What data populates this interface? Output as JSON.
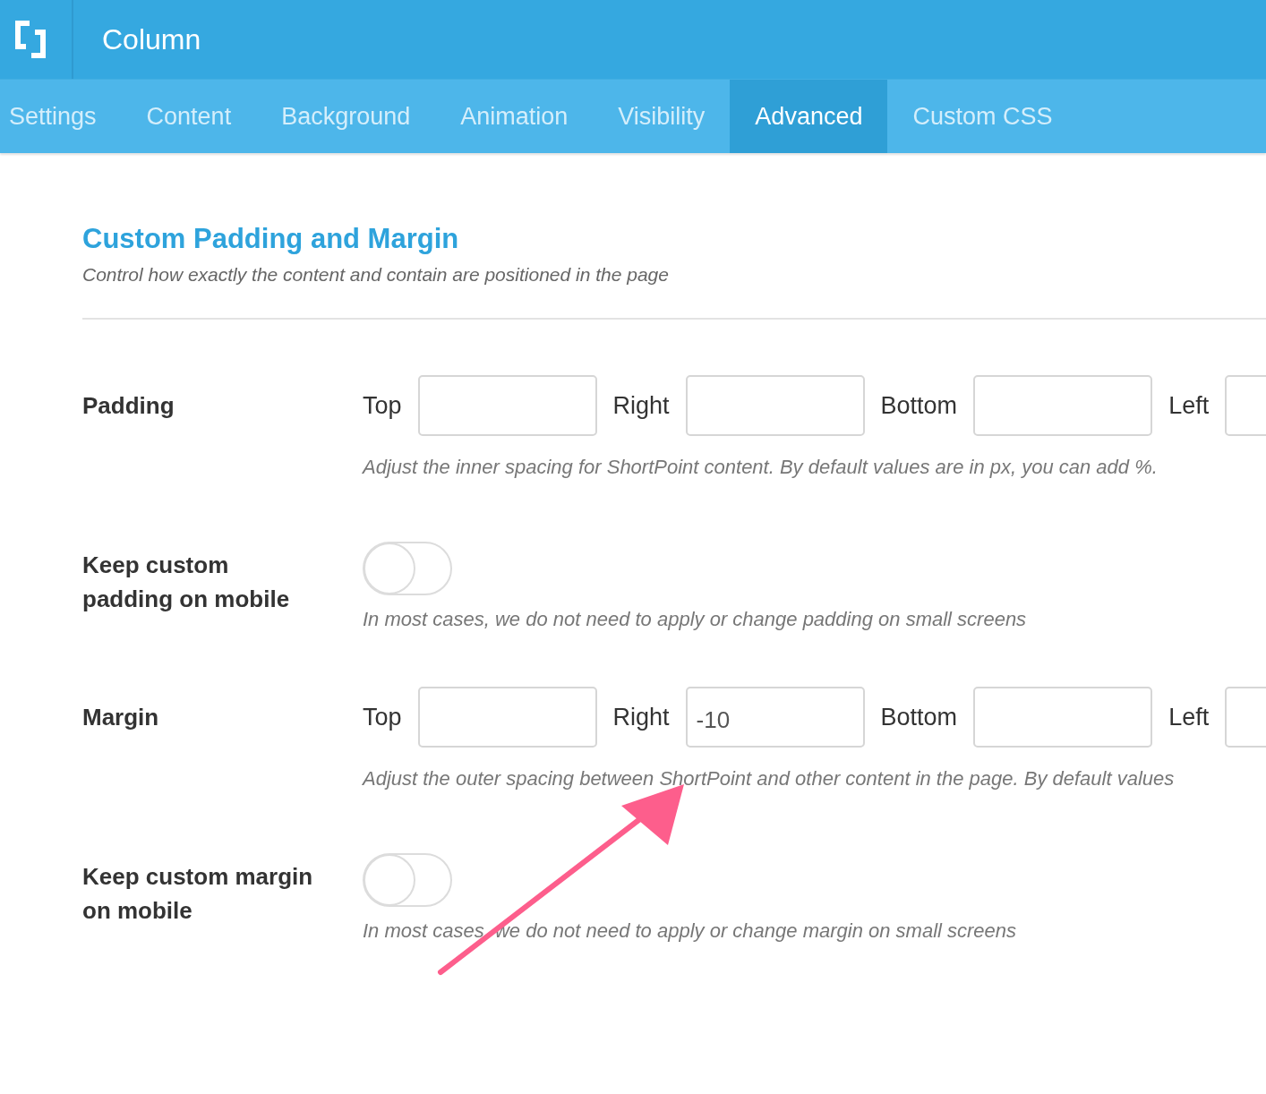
{
  "header": {
    "title": "Column"
  },
  "tabs": [
    {
      "label": "Settings",
      "selected": false
    },
    {
      "label": "Content",
      "selected": false
    },
    {
      "label": "Background",
      "selected": false
    },
    {
      "label": "Animation",
      "selected": false
    },
    {
      "label": "Visibility",
      "selected": false
    },
    {
      "label": "Advanced",
      "selected": true
    },
    {
      "label": "Custom CSS",
      "selected": false
    }
  ],
  "section": {
    "title": "Custom Padding and Margin",
    "description": "Control how exactly the content and contain are positioned in the page"
  },
  "rows": [
    {
      "kind": "fields",
      "label": "Padding",
      "fields": [
        {
          "label": "Top"
        },
        {
          "label": "Right"
        },
        {
          "label": "Bottom"
        },
        {
          "label": "Left"
        }
      ],
      "hint": "Adjust the inner spacing for ShortPoint content. By default values are in px, you can add %."
    },
    {
      "kind": "toggle",
      "label": "Keep custom padding on mobile",
      "on": false,
      "hint": "In most cases, we do not need to apply or change padding on small screens"
    },
    {
      "kind": "fields",
      "label": "Margin",
      "fields": [
        {
          "label": "Top"
        },
        {
          "label": "Right",
          "value": "-10"
        },
        {
          "label": "Bottom"
        },
        {
          "label": "Left"
        }
      ],
      "hint": "Adjust the outer spacing between ShortPoint and other content in the page. By default values"
    },
    {
      "kind": "toggle",
      "label": "Keep custom margin on mobile",
      "on": false,
      "hint": "In most cases, we do not need to apply or change margin on small screens"
    }
  ]
}
